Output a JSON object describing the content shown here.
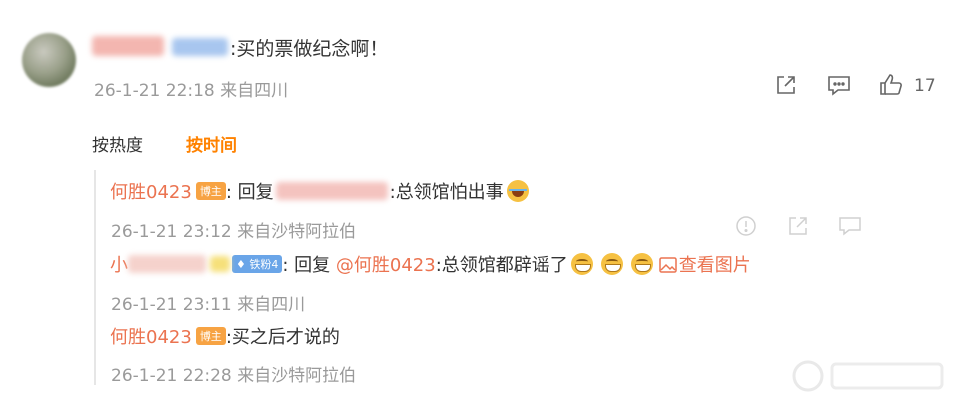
{
  "comment": {
    "text": "买的票做纪念啊！",
    "date": "26-1-21 22:18",
    "location": "来自四川",
    "like_count": "17",
    "colors": {
      "name": "#eb7350",
      "accent": "#ff8200",
      "meta": "#9a9a9a"
    }
  },
  "sort": {
    "hot_label": "按热度",
    "time_label": "按时间"
  },
  "replies": [
    {
      "author": "何胜0423",
      "badge": "博主",
      "reply_prefix": "回复",
      "text": "总领馆怕出事",
      "date": "26-1-21 23:12",
      "location": "来自沙特阿拉伯"
    },
    {
      "author_prefix": "小",
      "badge": "铁粉4",
      "reply_prefix": "回复",
      "mention": "@何胜0423",
      "text": "总领馆都辟谣了",
      "view_image": "查看图片",
      "date": "26-1-21 23:11",
      "location": "来自四川"
    },
    {
      "author": "何胜0423",
      "badge": "博主",
      "text": "买之后才说的",
      "date": "26-1-21 22:28",
      "location": "来自沙特阿拉伯"
    }
  ],
  "icons": [
    "share-icon",
    "comment-icon",
    "like-icon",
    "report-icon",
    "emoji-grin-icon",
    "emoji-laugh-icon",
    "image-icon"
  ]
}
